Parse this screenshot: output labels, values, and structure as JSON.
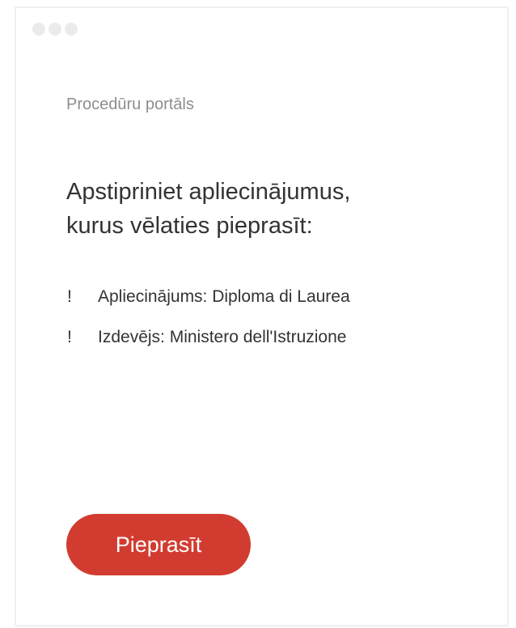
{
  "window": {
    "controls": [
      "window-dot",
      "window-dot",
      "window-dot"
    ]
  },
  "portal": {
    "label": "Procedūru portāls"
  },
  "main": {
    "heading_line1": "Apstipriniet apliecinājumus,",
    "heading_line2": "kurus vēlaties pieprasīt:",
    "items": [
      {
        "icon": "!",
        "icon_name": "exclamation-icon",
        "text": "Apliecinājums: Diploma di Laurea"
      },
      {
        "icon": "!",
        "icon_name": "exclamation-icon",
        "text": "Izdevējs: Ministero dell'Istruzione"
      }
    ],
    "button_label": "Pieprasīt"
  },
  "colors": {
    "accent": "#d23c30",
    "text": "#333333",
    "muted": "#8e8e8e",
    "border": "#f0f0f0",
    "dots": "#ebebeb"
  }
}
